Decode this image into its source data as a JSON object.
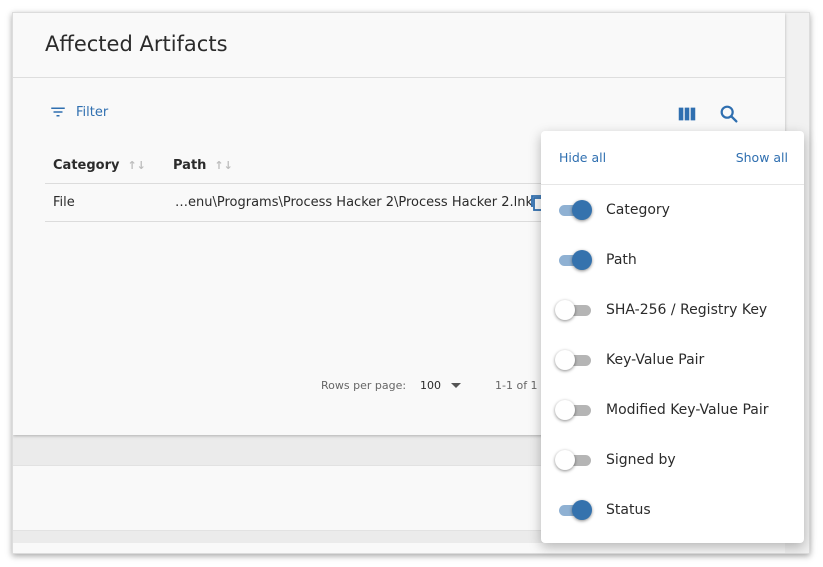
{
  "card": {
    "title": "Affected Artifacts"
  },
  "toolbar": {
    "filter_label": "Filter",
    "columns_icon": "view-column-icon",
    "search_icon": "search-icon"
  },
  "table": {
    "headers": {
      "category": "Category",
      "path": "Path"
    },
    "rows": [
      {
        "category": "File",
        "path": "…enu\\Programs\\Process Hacker 2\\Process Hacker 2.lnk"
      }
    ]
  },
  "pagination": {
    "rows_per_page_label": "Rows per page:",
    "rows_per_page_value": "100",
    "range": "1-1 of 1"
  },
  "column_menu": {
    "hide_all": "Hide all",
    "show_all": "Show all",
    "items": [
      {
        "label": "Category",
        "on": true
      },
      {
        "label": "Path",
        "on": true
      },
      {
        "label": "SHA-256 / Registry Key",
        "on": false
      },
      {
        "label": "Key-Value Pair",
        "on": false
      },
      {
        "label": "Modified Key-Value Pair",
        "on": false
      },
      {
        "label": "Signed by",
        "on": false
      },
      {
        "label": "Status",
        "on": true
      }
    ]
  },
  "colors": {
    "accent": "#2f6fb0",
    "switch_on": "#3572ad",
    "switch_on_track": "#8fb1d3"
  }
}
